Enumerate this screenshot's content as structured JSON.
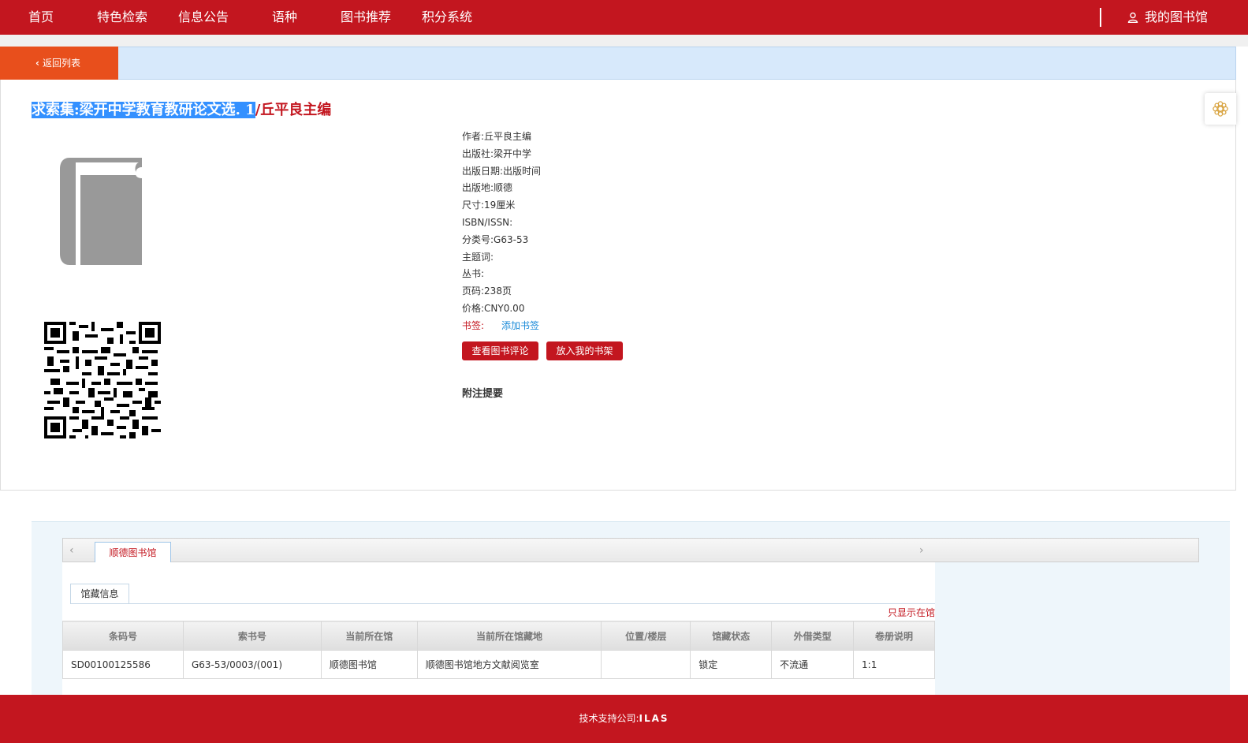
{
  "nav": {
    "items": [
      "首页",
      "特色检索",
      "信息公告",
      "语种",
      "图书推荐",
      "积分系统"
    ],
    "my_library": "我的图书馆"
  },
  "back_button": "返回列表",
  "book": {
    "title_selected": "求索集:梁开中学教育教研论文选. 1",
    "title_rest": "/丘平良主编",
    "meta": [
      {
        "label": "作者:",
        "value": "丘平良主编"
      },
      {
        "label": "出版社:",
        "value": "梁开中学"
      },
      {
        "label": "出版日期:",
        "value": "出版时间"
      },
      {
        "label": "出版地:",
        "value": "顺德"
      },
      {
        "label": "尺寸:",
        "value": "19厘米"
      },
      {
        "label": "ISBN/ISSN:",
        "value": ""
      },
      {
        "label": "分类号:",
        "value": "G63-53"
      },
      {
        "label": "主题词:",
        "value": ""
      },
      {
        "label": "丛书:",
        "value": ""
      },
      {
        "label": "页码:",
        "value": "238页"
      },
      {
        "label": "价格:",
        "value": "CNY0.00"
      }
    ],
    "bookmark_label": "书签:",
    "bookmark_link": "添加书签",
    "btn_review": "查看图书评论",
    "btn_shelf": "放入我的书架",
    "remark": "附注提要"
  },
  "holdings": {
    "library_tab": "顺德图书馆",
    "subtab": "馆藏信息",
    "only_in_library": "只显示在馆",
    "columns": [
      "条码号",
      "索书号",
      "当前所在馆",
      "当前所在馆藏地",
      "位置/楼层",
      "馆藏状态",
      "外借类型",
      "卷册说明"
    ],
    "rows": [
      [
        "SD00100125586",
        "G63-53/0003/(001)",
        "顺德图书馆",
        "顺德图书馆地方文献阅览室",
        "",
        "锁定",
        "不流通",
        "1:1"
      ]
    ]
  },
  "footer": {
    "label": "技术支持公司:",
    "company": "ILAS"
  },
  "colors": {
    "brand_red": "#c3161f",
    "back_orange": "#e84f1c",
    "link_blue": "#1a8ad8"
  }
}
